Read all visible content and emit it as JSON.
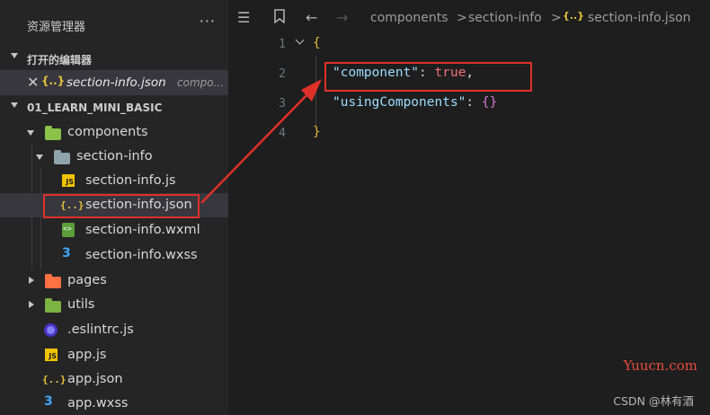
{
  "sidebar": {
    "title": "资源管理器",
    "more_glyph": "···",
    "open_editors": {
      "label": "打开的编辑器",
      "items": [
        {
          "close_glyph": "✕",
          "icon": "json-icon",
          "icon_glyph": "{..}",
          "name": "section-info.json",
          "path": "compo..."
        }
      ]
    },
    "project": {
      "label": "01_LEARN_MINI_BASIC",
      "tree": [
        {
          "label": "components",
          "icon": "folder-components-icon",
          "expanded": true
        },
        {
          "label": "section-info",
          "icon": "folder-open-icon",
          "expanded": true
        },
        {
          "label": "section-info.js",
          "icon": "js-file-icon",
          "icon_glyph": "JS"
        },
        {
          "label": "section-info.json",
          "icon": "json-file-icon",
          "icon_glyph": "{..}",
          "selected": true
        },
        {
          "label": "section-info.wxml",
          "icon": "wxml-file-icon"
        },
        {
          "label": "section-info.wxss",
          "icon": "css-file-icon",
          "icon_glyph": "3"
        },
        {
          "label": "pages",
          "icon": "folder-pages-icon",
          "expanded": false
        },
        {
          "label": "utils",
          "icon": "folder-utils-icon",
          "expanded": false
        },
        {
          "label": ".eslintrc.js",
          "icon": "eslint-icon"
        },
        {
          "label": "app.js",
          "icon": "js-file-icon",
          "icon_glyph": "JS"
        },
        {
          "label": "app.json",
          "icon": "json-file-icon",
          "icon_glyph": "{..}"
        },
        {
          "label": "app.wxss",
          "icon": "css-file-icon",
          "icon_glyph": "3"
        }
      ]
    }
  },
  "breadcrumb": {
    "icons": [
      "list-icon",
      "bookmark-icon",
      "back-arrow-icon",
      "forward-arrow-icon"
    ],
    "parts": [
      "components",
      "section-info",
      "section-info.json"
    ],
    "json_glyph": "{..}",
    "separator": ">"
  },
  "editor": {
    "lines": [
      {
        "number": "1",
        "open_brace": "{"
      },
      {
        "number": "2",
        "key": "\"component\"",
        "colon": ": ",
        "value": "true",
        "comma": ","
      },
      {
        "number": "3",
        "key": "\"usingComponents\"",
        "colon": ": ",
        "value": "{}"
      },
      {
        "number": "4",
        "close_brace": "}"
      }
    ]
  },
  "watermark": "Yuucn.com",
  "credit": "CSDN @林有酒",
  "colors": {
    "sidebar_bg": "#252526",
    "editor_bg": "#1e1e1e",
    "selection": "#37373d",
    "annotation_red": "#e0302a",
    "json_key": "#9cdcfe",
    "json_bool": "#f07178",
    "brace": "#e0b53a"
  }
}
